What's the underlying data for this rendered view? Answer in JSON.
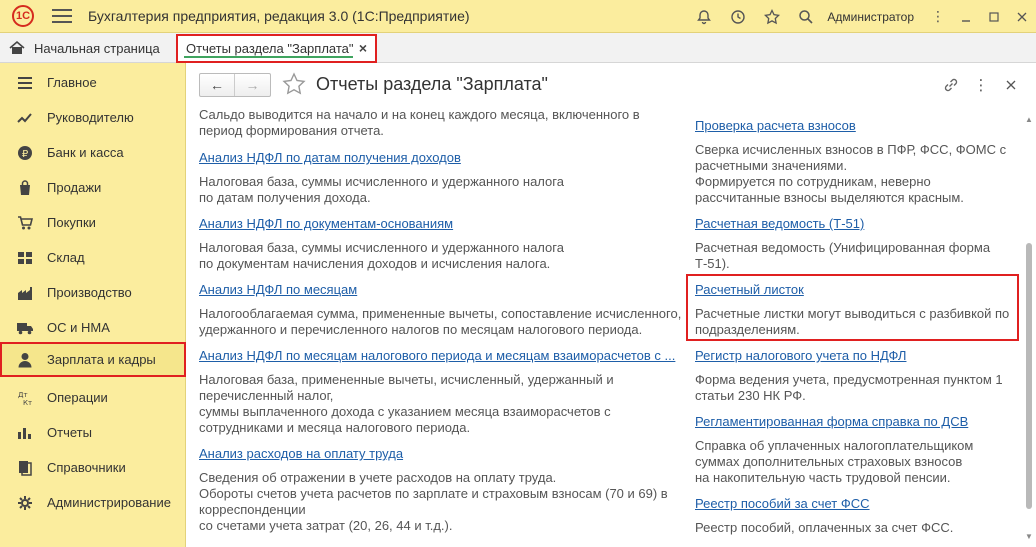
{
  "app": {
    "logo": "1С",
    "title": "Бухгалтерия предприятия, редакция 3.0  (1С:Предприятие)",
    "user": "Администратор"
  },
  "tabs": {
    "home": "Начальная страница",
    "active": "Отчеты раздела \"Зарплата\"",
    "close": "×"
  },
  "sidebar": {
    "items": [
      {
        "label": "Главное",
        "icon": "menu-lines-icon"
      },
      {
        "label": "Руководителю",
        "icon": "trend-chart-icon"
      },
      {
        "label": "Банк и касса",
        "icon": "ruble-coin-icon"
      },
      {
        "label": "Продажи",
        "icon": "shopping-bag-icon"
      },
      {
        "label": "Покупки",
        "icon": "shopping-cart-icon"
      },
      {
        "label": "Склад",
        "icon": "warehouse-grid-icon"
      },
      {
        "label": "Производство",
        "icon": "factory-icon"
      },
      {
        "label": "ОС и НМА",
        "icon": "truck-icon"
      },
      {
        "label": "Зарплата и кадры",
        "icon": "person-icon"
      },
      {
        "label": "Операции",
        "icon": "dt-kt-icon"
      },
      {
        "label": "Отчеты",
        "icon": "bar-chart-icon"
      },
      {
        "label": "Справочники",
        "icon": "books-icon"
      },
      {
        "label": "Администрирование",
        "icon": "gear-icon"
      }
    ]
  },
  "page": {
    "title": "Отчеты раздела \"Зарплата\"",
    "back": "←",
    "forward": "→"
  },
  "left": [
    {
      "link": "",
      "desc": [
        "Сальдо выводится на начало и на конец каждого месяца, включенного в",
        "период формирования отчета."
      ]
    },
    {
      "link": "Анализ НДФЛ по датам получения доходов",
      "desc": [
        "Налоговая база, суммы исчисленного и удержанного налога",
        "по датам получения дохода."
      ]
    },
    {
      "link": "Анализ НДФЛ по документам-основаниям",
      "desc": [
        "Налоговая база, суммы исчисленного и удержанного налога",
        "по документам начисления доходов и исчисления налога."
      ]
    },
    {
      "link": "Анализ НДФЛ по месяцам",
      "desc": [
        "Налогооблагаемая сумма, примененные вычеты, сопоставление исчисленного,",
        "удержанного и перечисленного налогов по месяцам налогового периода."
      ]
    },
    {
      "link": "Анализ НДФЛ по месяцам налогового периода и месяцам взаиморасчетов с ...",
      "desc": [
        "Налоговая база, примененные вычеты, исчисленный, удержанный и",
        "перечисленный налог,",
        "суммы выплаченного дохода с указанием месяца взаиморасчетов с",
        "сотрудниками и месяца налогового периода."
      ]
    },
    {
      "link": "Анализ расходов на оплату труда",
      "desc": [
        "Сведения об отражении в учете расходов на оплату труда.",
        "Обороты счетов учета расчетов по зарплате и страховым взносам (70 и 69) в",
        "корреспонденции",
        "со счетами учета затрат (20, 26, 44 и т.д.)."
      ]
    }
  ],
  "right": [
    {
      "link": "Проверка расчета взносов",
      "desc": [
        "Сверка исчисленных взносов в ПФР, ФСС, ФОМС с",
        "расчетными значениями.",
        "Формируется по сотрудникам, неверно",
        "рассчитанные взносы выделяются красным."
      ]
    },
    {
      "link": "Расчетная ведомость (Т-51)",
      "desc": [
        "Расчетная ведомость (Унифицированная форма",
        "Т-51)."
      ]
    },
    {
      "link": "Расчетный листок",
      "desc": [
        "Расчетные листки могут выводиться с разбивкой по",
        "подразделениям."
      ]
    },
    {
      "link": "Регистр налогового учета по НДФЛ",
      "desc": [
        "Форма ведения учета, предусмотренная пунктом 1",
        "статьи 230 НК РФ."
      ]
    },
    {
      "link": "Регламентированная форма справка по ДСВ",
      "desc": [
        "Справка об уплаченных налогоплательщиком",
        "суммах дополнительных страховых взносов",
        "на накопительную часть трудовой пенсии."
      ]
    },
    {
      "link": "Реестр пособий за счет ФСС",
      "desc": [
        "Реестр пособий, оплаченных за счет ФСС."
      ]
    }
  ],
  "colors": {
    "sidebar_bg": "#fbed9e",
    "link": "#1e5ea8",
    "highlight": "#e02020"
  }
}
